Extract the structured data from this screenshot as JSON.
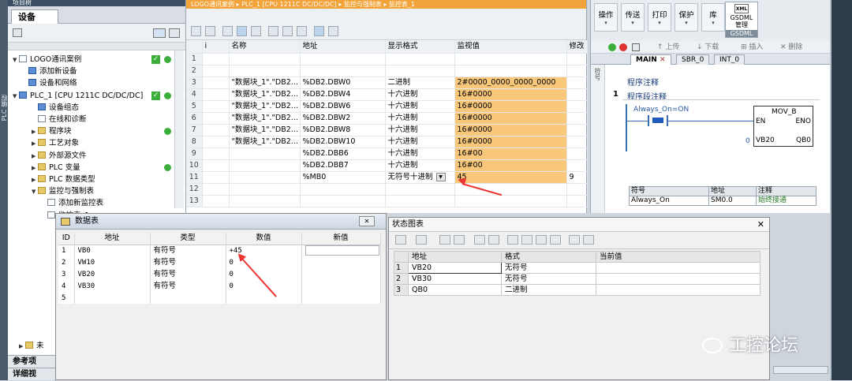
{
  "tree": {
    "top_header": "项目树",
    "tab_label": "设备",
    "items": [
      {
        "label": "LOGO通讯案例",
        "depth": 0,
        "expander": "▼",
        "icon": "doc"
      },
      {
        "label": "添加新设备",
        "depth": 1,
        "expander": "",
        "icon": "blue"
      },
      {
        "label": "设备和网络",
        "depth": 1,
        "expander": "",
        "icon": "blue"
      },
      {
        "label": "PLC_1 [CPU 1211C DC/DC/DC]",
        "depth": 0,
        "expander": "▼",
        "icon": "blue"
      },
      {
        "label": "设备组态",
        "depth": 2,
        "expander": "",
        "icon": "blue"
      },
      {
        "label": "在线和诊断",
        "depth": 2,
        "expander": "",
        "icon": "doc"
      },
      {
        "label": "程序块",
        "depth": 2,
        "expander": "▶",
        "icon": "folder"
      },
      {
        "label": "工艺对象",
        "depth": 2,
        "expander": "▶",
        "icon": "folder"
      },
      {
        "label": "外部源文件",
        "depth": 2,
        "expander": "▶",
        "icon": "folder"
      },
      {
        "label": "PLC 变量",
        "depth": 2,
        "expander": "▶",
        "icon": "folder"
      },
      {
        "label": "PLC 数据类型",
        "depth": 2,
        "expander": "▶",
        "icon": "folder"
      },
      {
        "label": "监控与强制表",
        "depth": 2,
        "expander": "▼",
        "icon": "folder"
      },
      {
        "label": "添加新监控表",
        "depth": 3,
        "expander": "",
        "icon": "doc"
      },
      {
        "label": "监控表_1",
        "depth": 3,
        "expander": "",
        "icon": "doc"
      }
    ],
    "partial_label": "未",
    "bottom_panels": [
      "参考项",
      "详细视"
    ]
  },
  "monitor": {
    "breadcrumb": "LOGO通讯案例 ▸ PLC_1 [CPU 1211C DC/DC/DC] ▸ 监控与强制表 ▸ 监控表_1",
    "columns": [
      "",
      "i",
      "名称",
      "地址",
      "显示格式",
      "监视值",
      "修改"
    ],
    "rows": [
      {
        "n": "1",
        "name": "",
        "addr": "",
        "fmt": "",
        "val": "",
        "mod": "",
        "hl": false
      },
      {
        "n": "2",
        "name": "",
        "addr": "",
        "fmt": "",
        "val": "",
        "mod": "",
        "hl": false
      },
      {
        "n": "3",
        "name": "\"数据块_1\".\"DB2...",
        "addr": "%DB2.DBW0",
        "fmt": "二进制",
        "val": "2#0000_0000_0000_0000",
        "mod": "",
        "hl": true
      },
      {
        "n": "4",
        "name": "\"数据块_1\".\"DB2...",
        "addr": "%DB2.DBW4",
        "fmt": "十六进制",
        "val": "16#0000",
        "mod": "",
        "hl": true
      },
      {
        "n": "5",
        "name": "\"数据块_1\".\"DB2...",
        "addr": "%DB2.DBW6",
        "fmt": "十六进制",
        "val": "16#0000",
        "mod": "",
        "hl": true
      },
      {
        "n": "6",
        "name": "\"数据块_1\".\"DB2...",
        "addr": "%DB2.DBW2",
        "fmt": "十六进制",
        "val": "16#0000",
        "mod": "",
        "hl": true
      },
      {
        "n": "7",
        "name": "\"数据块_1\".\"DB2...",
        "addr": "%DB2.DBW8",
        "fmt": "十六进制",
        "val": "16#0000",
        "mod": "",
        "hl": true
      },
      {
        "n": "8",
        "name": "\"数据块_1\".\"DB2...",
        "addr": "%DB2.DBW10",
        "fmt": "十六进制",
        "val": "16#0000",
        "mod": "",
        "hl": true
      },
      {
        "n": "9",
        "name": "",
        "addr": "%DB2.DBB6",
        "fmt": "十六进制",
        "val": "16#00",
        "mod": "",
        "hl": true
      },
      {
        "n": "10",
        "name": "",
        "addr": "%DB2.DBB7",
        "fmt": "十六进制",
        "val": "16#00",
        "mod": "",
        "hl": true
      },
      {
        "n": "11",
        "name": "",
        "addr": "%MB0",
        "fmt": "无符号十进制",
        "val": "45",
        "mod": "9",
        "hl": true,
        "dropdown": true
      },
      {
        "n": "12",
        "name": "",
        "addr": "",
        "fmt": "",
        "val": "",
        "mod": "",
        "hl": false
      },
      {
        "n": "13",
        "name": "",
        "addr": "",
        "fmt": "",
        "val": "",
        "mod": "",
        "hl": false
      }
    ]
  },
  "ribbon": {
    "buttons": [
      "操作",
      "传送",
      "打印",
      "保护",
      "库"
    ],
    "gsdml_icon": "XML",
    "gsdml_label": "GSDML\n管理",
    "gsdml_group": "GSDML"
  },
  "editor": {
    "toolbar_items": [
      "上传",
      "下载",
      "插入",
      "删除"
    ],
    "tabs": [
      "MAIN",
      "SBR_0",
      "INT_0"
    ],
    "side_label": "符号",
    "program_comment": "程序注释",
    "network_number": "1",
    "network_comment": "程序段注释",
    "contact_label": "Always_On=ON",
    "block_name": "MOV_B",
    "en": "EN",
    "eno": "ENO",
    "in_value": "0",
    "in_pin": "VB20",
    "out_pin": "QB0",
    "symbol_headers": [
      "符号",
      "地址",
      "注释"
    ],
    "symbol_row": [
      "Always_On",
      "SM0.0",
      "始终接通"
    ]
  },
  "data_window": {
    "title": "数据表",
    "columns": [
      "ID",
      "地址",
      "类型",
      "数值",
      "新值"
    ],
    "rows": [
      {
        "id": "1",
        "addr": "VB0",
        "type": "有符号",
        "val": "+45"
      },
      {
        "id": "2",
        "addr": "VW10",
        "type": "有符号",
        "val": "0"
      },
      {
        "id": "3",
        "addr": "VB20",
        "type": "有符号",
        "val": "0"
      },
      {
        "id": "4",
        "addr": "VB30",
        "type": "有符号",
        "val": "0"
      },
      {
        "id": "5",
        "addr": "",
        "type": "",
        "val": ""
      }
    ]
  },
  "status_window": {
    "title": "状态图表",
    "columns": [
      "",
      "地址",
      "格式",
      "当前值"
    ],
    "rows": [
      {
        "n": "1",
        "addr": "VB20",
        "fmt": "无符号",
        "val": ""
      },
      {
        "n": "2",
        "addr": "VB30",
        "fmt": "无符号",
        "val": ""
      },
      {
        "n": "3",
        "addr": "QB0",
        "fmt": "二进制",
        "val": ""
      }
    ]
  },
  "watermark": "工控论坛",
  "left_strip_label": "PLC 编程",
  "colors": {
    "accent_orange": "#f2a339",
    "highlight": "#f8c77a",
    "arrow_red": "#e33333",
    "status_green": "#3cae3c"
  }
}
